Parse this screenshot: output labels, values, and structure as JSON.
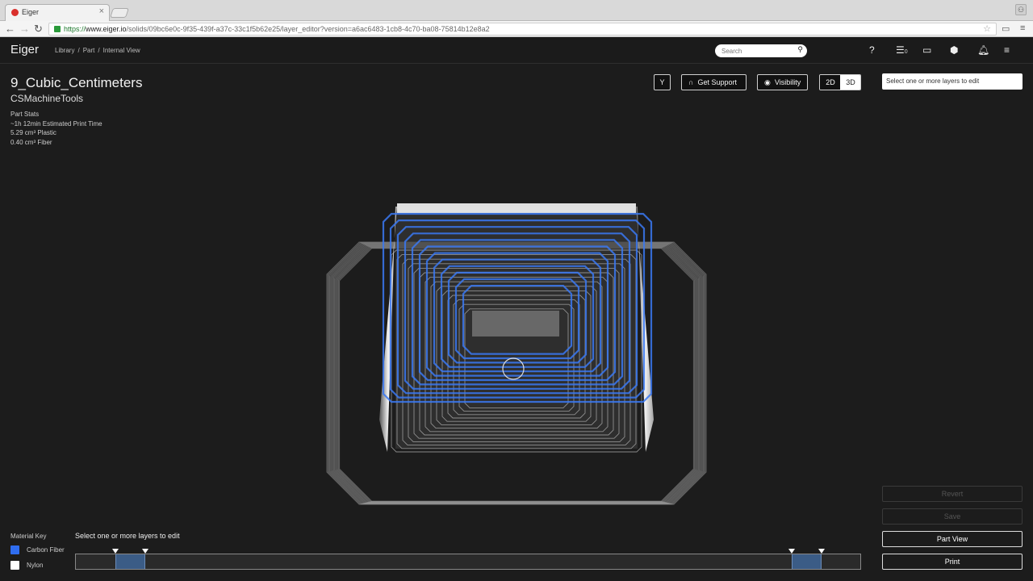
{
  "browser": {
    "tab_title": "Eiger",
    "url_scheme": "https://",
    "url_host": "www.eiger.io",
    "url_path": "/solids/09bc6e0c-9f35-439f-a37c-33c1f5b62e25/layer_editor?version=a6ac6483-1cb8-4c70-ba08-75814b12e8a2"
  },
  "header": {
    "logo": "Eiger",
    "breadcrumbs": [
      "Library",
      "/",
      "Part",
      "/",
      "Internal View"
    ],
    "search_placeholder": "Search",
    "queue_count": "0",
    "icons": [
      "help-icon",
      "queue-icon",
      "printer-icon",
      "cube-icon",
      "bell-icon",
      "menu-icon"
    ]
  },
  "part": {
    "title": "9_Cubic_Centimeters",
    "owner": "CSMachineTools",
    "stats_heading": "Part Stats",
    "stats": [
      "~1h 12min Estimated Print Time",
      "5.29 cm³ Plastic",
      "0.40 cm³ Fiber"
    ]
  },
  "toolbar": {
    "version_icon": "Y",
    "support_label": "Get Support",
    "visibility_label": "Visibility",
    "mode_2d": "2D",
    "mode_3d": "3D",
    "layer_select_text": "Select one or more layers to edit"
  },
  "material_key": {
    "title": "Material Key",
    "items": [
      {
        "label": "Carbon Fiber",
        "color": "#2f6df0"
      },
      {
        "label": "Nylon",
        "color": "#ffffff"
      }
    ]
  },
  "layers": {
    "hint": "Select one or more layers to edit",
    "selected_ranges_fraction": [
      [
        0.05,
        0.088
      ],
      [
        0.913,
        0.951
      ]
    ]
  },
  "actions": {
    "revert": "Revert",
    "save": "Save",
    "part_view": "Part View",
    "print": "Print"
  }
}
